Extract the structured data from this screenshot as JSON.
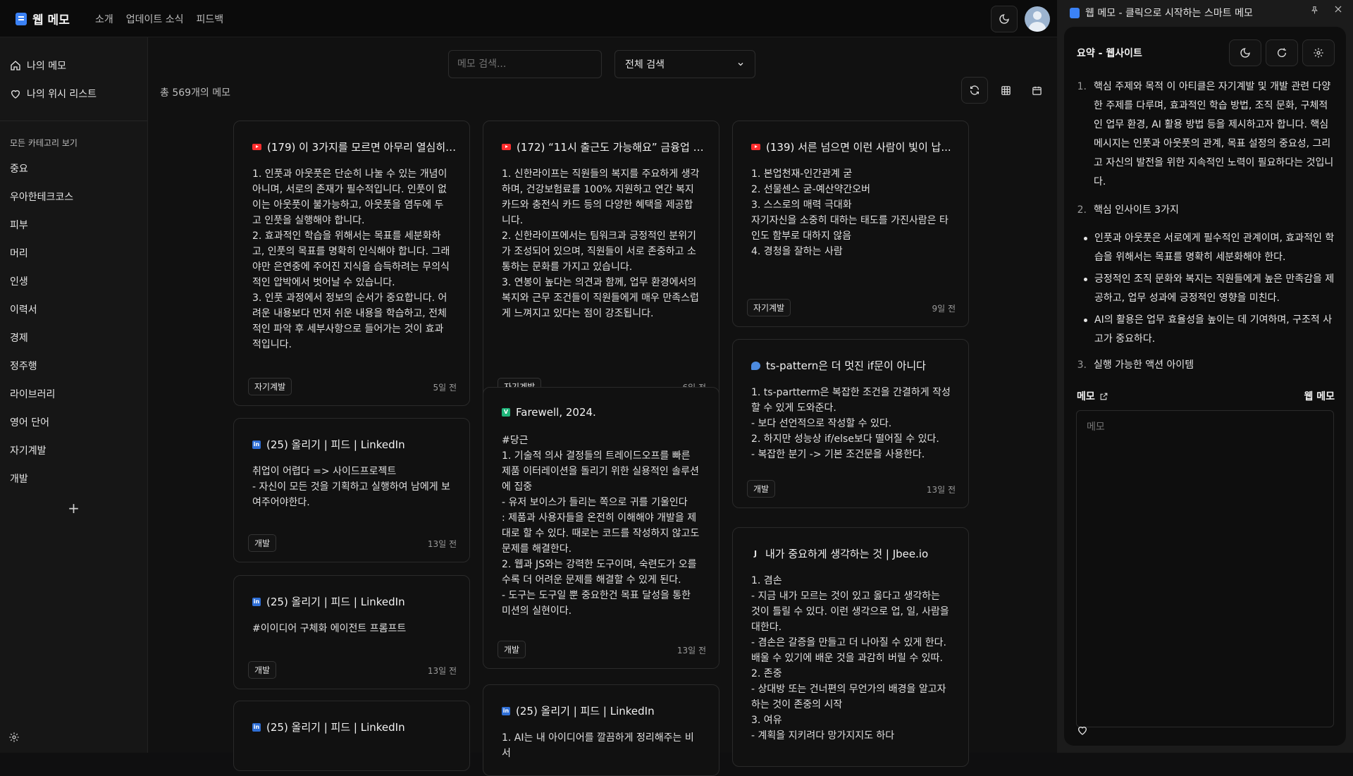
{
  "header": {
    "brand": "웹 메모",
    "nav": [
      "소개",
      "업데이트 소식",
      "피드백"
    ]
  },
  "sidebar": {
    "links": [
      "나의 메모",
      "나의 위시 리스트"
    ],
    "category_heading": "모든 카테고리 보기",
    "categories": [
      "중요",
      "우아한테크코스",
      "피부",
      "머리",
      "인생",
      "이력서",
      "경제",
      "정주행",
      "라이브러리",
      "영어 단어",
      "자기계발",
      "개발"
    ],
    "add": "+"
  },
  "main": {
    "search_placeholder": "메모 검색...",
    "search_scope": "전체 검색",
    "count": "총 569개의 메모"
  },
  "cards": [
    {
      "icon": "youtube-icon",
      "title": "(179) 이 3가지를 모르면 아무리 열심히 ...",
      "body": "1. 인풋과 아웃풋은 단순히 나눌 수 있는 개념이 아니며, 서로의 존재가 필수적입니다. 인풋이 없이는 아웃풋이 불가능하고, 아웃풋을 염두에 두고 인풋을 실행해야 합니다.\n2. 효과적인 학습을 위해서는 목표를 세분화하고, 인풋의 목표를 명확히 인식해야 합니다. 그래야만 은연중에 주어진 지식을 습득하려는 무의식적인 압박에서 벗어날 수 있습니다.\n3. 인풋 과정에서 정보의 순서가 중요합니다. 어려운 내용보다 먼저 쉬운 내용을 학습하고, 전체적인 파악 후 세부사항으로 들어가는 것이 효과적입니다.",
      "tag": "자기계발",
      "date": "5일 전"
    },
    {
      "icon": "linkedin-icon",
      "title": "(25) 올리기 | 피드 | LinkedIn",
      "body": "취업이 어렵다 => 사이드프로젝트\n- 자신이 모든 것을 기획하고 실행하여 남에게 보여주어야한다.",
      "tag": "개발",
      "date": "13일 전"
    },
    {
      "icon": "linkedin-icon",
      "title": "(25) 올리기 | 피드 | LinkedIn",
      "body": "#이이디어 구체화 에이전트 프롬프트",
      "tag": "개발",
      "date": "13일 전"
    },
    {
      "icon": "linkedin-icon",
      "title": "(25) 올리기 | 피드 | LinkedIn",
      "body": "",
      "tag": "",
      "date": ""
    },
    {
      "icon": "youtube-icon",
      "title": "(172) “11시 출근도 가능해요” 금융업 7...",
      "body": "1. 신한라이프는 직원들의 복지를 주요하게 생각하며, 건강보험료를 100% 지원하고 연간 복지 카드와 충전식 카드 등의 다양한 혜택을 제공합니다.\n2. 신한라이프에서는 팀워크과 긍정적인 분위기가 조성되어 있으며, 직원들이 서로 존중하고 소통하는 문화를 가지고 있습니다.\n3. 연봉이 높다는 의견과 함께, 업무 환경에서의 복지와 근무 조건들이 직원들에게 매우 만족스럽게 느껴지고 있다는 점이 강조됩니다.",
      "tag": "자기계발",
      "date": "6일 전"
    },
    {
      "icon": "v-icon",
      "title": "Farewell, 2024.",
      "body": "#당근\n1. 기술적 의사 결정들의 트레이드오프를 빠른 제품 이터레이션을 돌리기 위한 실용적인 솔루션에 집중\n- 유저 보이스가 들리는 쪽으로 귀를 기울인다\n: 제품과 사용자들을 온전히 이해해야 개발을 제대로 할 수 있다. 때로는 코드를 작성하지 않고도 문제를 해결한다.\n2. 웹과 JS와는 강력한 도구이며, 숙련도가 오를수록 더 어려운 문제를 해결할 수 있게 된다.\n- 도구는 도구일 뿐 중요한건 목표 달성을 통한 미션의 실현이다.",
      "tag": "개발",
      "date": "13일 전"
    },
    {
      "icon": "linkedin-icon",
      "title": "(25) 올리기 | 피드 | LinkedIn",
      "body": "1. AI는 내 아이디어를 깔끔하게 정리해주는 비서",
      "tag": "",
      "date": ""
    },
    {
      "icon": "youtube-icon",
      "title": "(139) 서른 넘으면 이런 사람이 빛이 납...",
      "body": "1. 본업천재-인간관계 굳\n2. 선물센스 굳-예산약간오버\n3. 스스로의 매력 극대화\n자기자신을 소중히 대하는 태도를 가진사람은 타인도 함부로 대하지 않음\n4. 경청을 잘하는 사람",
      "tag": "자기계발",
      "date": "9일 전"
    },
    {
      "icon": "ts-icon",
      "title": "ts-pattern은 더 멋진 if문이 아니다",
      "body": "1. ts-partterm은 복잡한 조건을 간결하게 작성할 수 있게 도와준다.\n- 보다 선언적으로 작성할 수 있다.\n2. 하지만 성능상 if/else보다 떨어질 수 있다.\n- 복잡한 분기 -> 기본 조건문을 사용한다.",
      "tag": "개발",
      "date": "13일 전"
    },
    {
      "icon": "jbee-icon",
      "title": "내가 중요하게 생각하는 것 | Jbee.io",
      "body": "1. 겸손\n- 지금 내가 모르는 것이 있고 옳다고 생각하는 것이 틀릴 수 있다. 이런 생각으로 업, 일, 사람을 대한다.\n- 겸손은 갈증을 만들고 더 나아질 수 있게 한다. 배울 수 있기에 배운 것을 과감히 버릴 수 있따.\n2. 존중\n- 상대방 또는 건너편의 무언가의 배경을 알고자 하는 것이 존중의 시작\n3. 여유\n- 계획을 지키려다 망가지지도 하다",
      "tag": "",
      "date": ""
    }
  ],
  "panel": {
    "title": "웹 메모 - 클릭으로 시작하는 스마트 메모",
    "summary_title": "요약 - 웹사이트",
    "summary": [
      {
        "num": "1.",
        "text": "핵심 주제와 목적 이 아티클은 자기계발 및 개발 관련 다양한 주제를 다루며, 효과적인 학습 방법, 조직 문화, 구체적인 업무 환경, AI 활용 방법 등을 제시하고자 합니다. 핵심 메시지는 인풋과 아웃풋의 관계, 목표 설정의 중요성, 그리고 자신의 발전을 위한 지속적인 노력이 필요하다는 것입니다."
      },
      {
        "num": "2.",
        "text": "핵심 인사이트 3가지"
      }
    ],
    "bullets": [
      "인풋과 아웃풋은 서로에게 필수적인 관계이며, 효과적인 학습을 위해서는 목표를 명확히 세분화해야 한다.",
      "긍정적인 조직 문화와 복지는 직원들에게 높은 만족감을 제공하고, 업무 성과에 긍정적인 영향을 미친다.",
      "AI의 활용은 업무 효율성을 높이는 데 기여하며, 구조적 사고가 중요하다."
    ],
    "summary_last": {
      "num": "3.",
      "text": "실행 가능한 액션 아이템"
    },
    "memo_label": "메모",
    "memo_right": "웹 메모",
    "memo_placeholder": "메모"
  }
}
